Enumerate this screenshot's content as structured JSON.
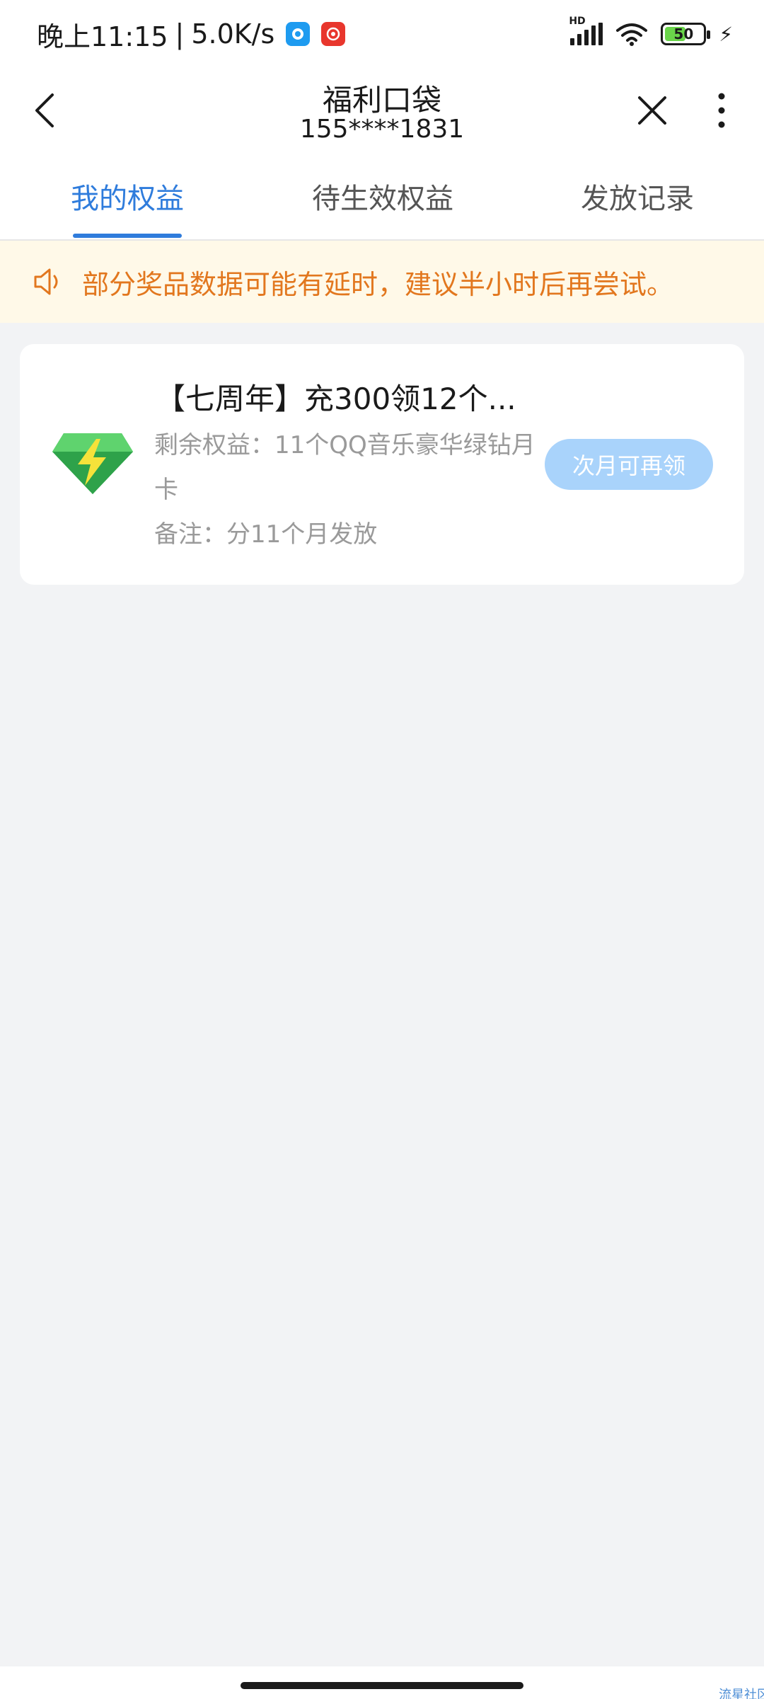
{
  "status_bar": {
    "time": "晚上11:15",
    "separator": "|",
    "net_speed": "5.0K/s",
    "hd_label": "HD",
    "battery_level": "50",
    "colors": {
      "app1": "#1e9bf0",
      "app2": "#e8362d",
      "battery_fill": "#6ad54a"
    }
  },
  "header": {
    "title": "福利口袋",
    "subtitle": "155****1831",
    "icons": {
      "back": "chevron-left-icon",
      "close": "close-icon",
      "more": "more-vertical-icon"
    }
  },
  "tabs": [
    {
      "label": "我的权益",
      "active": true
    },
    {
      "label": "待生效权益",
      "active": false
    },
    {
      "label": "发放记录",
      "active": false
    }
  ],
  "notice": {
    "text": "部分奖品数据可能有延时，建议半小时后再尝试。",
    "icon": "speaker-icon",
    "color": "#e2771e"
  },
  "benefits": [
    {
      "title": "【七周年】充300领12个...",
      "remaining": "剩余权益：11个QQ音乐豪华绿钻月卡",
      "note": "备注：分11个月发放",
      "button_label": "次月可再领",
      "icon": "green-diamond-icon"
    }
  ],
  "watermark": "流星社区",
  "accent_color": "#2f7cdc"
}
